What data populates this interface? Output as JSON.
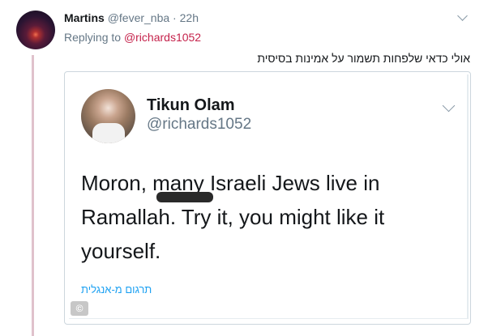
{
  "reply": {
    "name": "Martins",
    "handle": "@fever_nba",
    "separator": " · ",
    "time": "22h",
    "replying_prefix": "Replying to ",
    "replying_to": "@richards1052",
    "text": "אולי כדאי שלפחות תשמור על אמינות בסיסית"
  },
  "quoted": {
    "name": "Tikun Olam",
    "handle": "@richards1052",
    "body": "Moron, many Israeli Jews live in Ramallah. Try it, you might like it yourself.",
    "translate_label": "תרגום מ-אנגלית",
    "watermark_glyph": "©"
  },
  "icons": {
    "menu": "chevron-down-icon",
    "quote_menu": "chevron-down-icon"
  },
  "colors": {
    "thread_line": "#e0c2cc",
    "link": "#c5224b",
    "translate": "#1da1f2",
    "muted": "#657786"
  }
}
